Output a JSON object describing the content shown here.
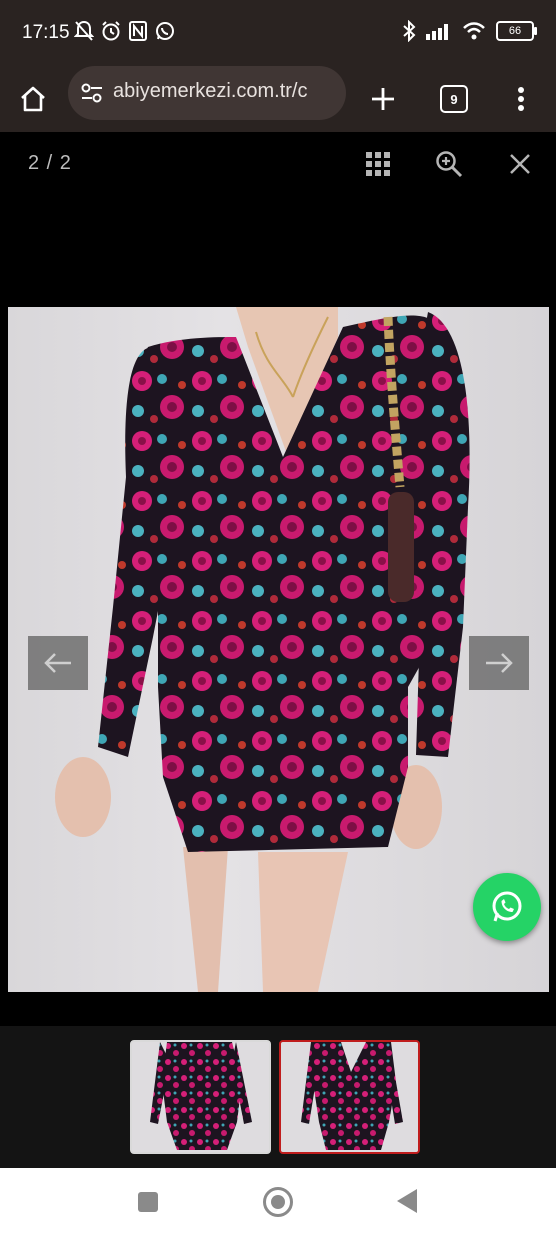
{
  "status_bar": {
    "time": "17:15",
    "left_icons": [
      "bell-off-icon",
      "alarm-icon",
      "nfc-icon",
      "whatsapp-icon"
    ],
    "right_icons": [
      "bluetooth-icon",
      "signal-icon",
      "wifi-icon"
    ],
    "battery": "66"
  },
  "browser": {
    "url": "abiyemerkezi.com.tr/c",
    "tab_count": "9"
  },
  "lightbox": {
    "counter": "2 / 2",
    "current_index": 2,
    "total": 2
  },
  "colors": {
    "toolbar_bg": "#2a2321",
    "urlbar_bg": "#403634",
    "whatsapp_green": "#25d366",
    "active_thumb_border": "#c01d1d"
  }
}
